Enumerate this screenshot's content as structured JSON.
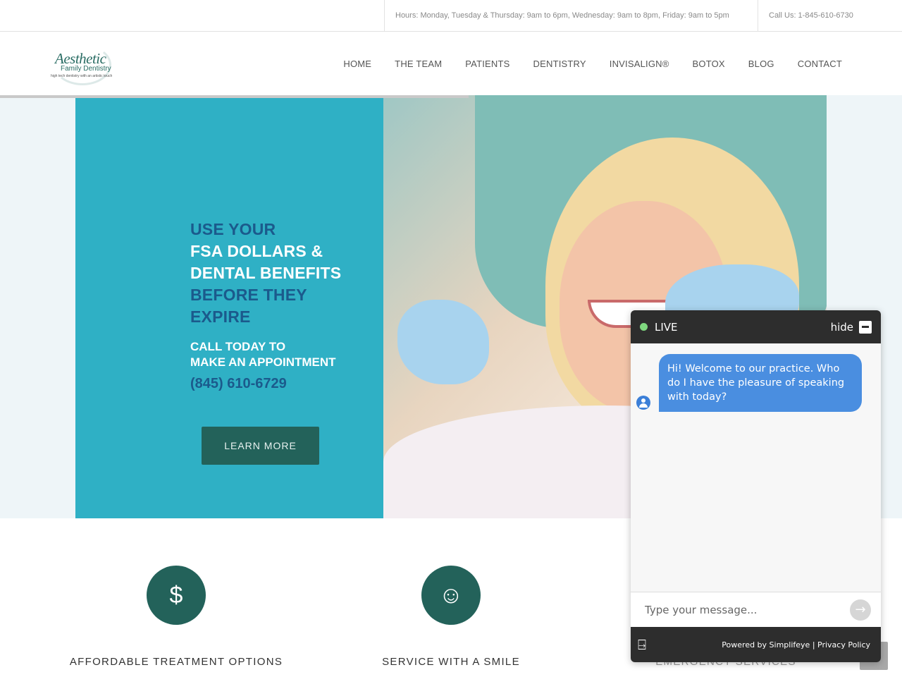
{
  "topbar": {
    "hours": "Hours: Monday, Tuesday & Thursday: 9am to 6pm, Wednesday: 9am to 8pm, Friday: 9am to 5pm",
    "call": "Call Us: 1-845-610-6730"
  },
  "logo": {
    "line1": "Aesthetic",
    "line2": "Family Dentistry",
    "tagline": "high tech dentistry with an artistic touch"
  },
  "nav": {
    "items": [
      {
        "label": "HOME"
      },
      {
        "label": "THE TEAM"
      },
      {
        "label": "PATIENTS"
      },
      {
        "label": "DENTISTRY"
      },
      {
        "label": "INVISALIGN®"
      },
      {
        "label": "BOTOX"
      },
      {
        "label": "BLOG"
      },
      {
        "label": "CONTACT"
      }
    ]
  },
  "hero": {
    "line1": "USE YOUR",
    "line2": "FSA DOLLARS &",
    "line3": "DENTAL BENEFITS",
    "line4": "BEFORE THEY",
    "line5": "EXPIRE",
    "call1": "CALL TODAY TO",
    "call2": "MAKE AN APPOINTMENT",
    "phone": "(845) 610-6729",
    "button": "LEARN MORE",
    "colors": {
      "panel": "#2fb0c5",
      "dark_text": "#1b5a8c",
      "button": "#23625a"
    }
  },
  "features": [
    {
      "icon": "dollar-icon",
      "glyph": "$",
      "title": "AFFORDABLE TREATMENT OPTIONS"
    },
    {
      "icon": "smile-icon",
      "glyph": "☺",
      "title": "SERVICE WITH A SMILE"
    },
    {
      "icon": "emergency-icon",
      "glyph": "",
      "title": "EMERGENCY SERVICES"
    }
  ],
  "chat": {
    "status": "LIVE",
    "hide": "hide",
    "message": "Hi! Welcome to our practice.  Who do I have the pleasure of speaking with today?",
    "placeholder": "Type your message...",
    "powered": "Powered by Simplifeye",
    "separator": " | ",
    "privacy": "Privacy Policy"
  }
}
